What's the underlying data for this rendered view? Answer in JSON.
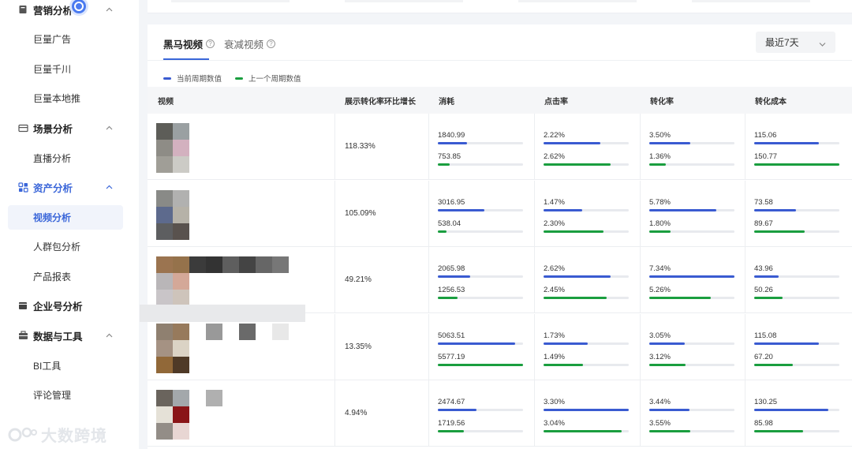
{
  "sidebar": {
    "groups": [
      {
        "label": "营销分析",
        "icon": "doc-icon"
      },
      {
        "label": "场景分析",
        "icon": "card-icon"
      },
      {
        "label": "资产分析",
        "icon": "assets-icon"
      },
      {
        "label": "企业号分析",
        "icon": "enterprise-icon"
      },
      {
        "label": "数据与工具",
        "icon": "toolbox-icon"
      }
    ],
    "items": [
      {
        "label": "巨量广告"
      },
      {
        "label": "巨量千川"
      },
      {
        "label": "巨量本地推"
      },
      {
        "label": "直播分析"
      },
      {
        "label": "视频分析"
      },
      {
        "label": "人群包分析"
      },
      {
        "label": "产品报表"
      },
      {
        "label": "BI工具"
      },
      {
        "label": "评论管理"
      }
    ],
    "watermark": "大数跨境"
  },
  "tabs": [
    {
      "label": "黑马视频"
    },
    {
      "label": "衰减视频"
    }
  ],
  "period_select": {
    "value": "最近7天"
  },
  "legend": [
    {
      "label": "当前周期数值",
      "color": "#3a5bd1"
    },
    {
      "label": "上一个周期数值",
      "color": "#1a9e3f"
    }
  ],
  "columns": [
    "视频",
    "展示转化率环比增长",
    "消耗",
    "点击率",
    "转化率",
    "转化成本"
  ],
  "rows": [
    {
      "growth": "118.33%",
      "spend": [
        "1840.99",
        "753.85"
      ],
      "spend_bar": [
        0.34,
        0.14
      ],
      "ctr": [
        "2.22%",
        "2.62%"
      ],
      "ctr_bar": [
        0.67,
        0.79
      ],
      "cvr": [
        "3.50%",
        "1.36%"
      ],
      "cvr_bar": [
        0.48,
        0.19
      ],
      "cost": [
        "115.06",
        "150.77"
      ],
      "cost_bar": [
        0.76,
        1.0
      ]
    },
    {
      "growth": "105.09%",
      "spend": [
        "3016.95",
        "538.04"
      ],
      "spend_bar": [
        0.55,
        0.1
      ],
      "ctr": [
        "1.47%",
        "2.30%"
      ],
      "ctr_bar": [
        0.45,
        0.7
      ],
      "cvr": [
        "5.78%",
        "1.80%"
      ],
      "cvr_bar": [
        0.79,
        0.25
      ],
      "cost": [
        "73.58",
        "89.67"
      ],
      "cost_bar": [
        0.49,
        0.59
      ]
    },
    {
      "growth": "49.21%",
      "spend": [
        "2065.98",
        "1256.53"
      ],
      "spend_bar": [
        0.38,
        0.23
      ],
      "ctr": [
        "2.62%",
        "2.45%"
      ],
      "ctr_bar": [
        0.79,
        0.74
      ],
      "cvr": [
        "7.34%",
        "5.26%"
      ],
      "cvr_bar": [
        1.0,
        0.72
      ],
      "cost": [
        "43.96",
        "50.26"
      ],
      "cost_bar": [
        0.29,
        0.33
      ]
    },
    {
      "growth": "13.35%",
      "spend": [
        "5063.51",
        "5577.19"
      ],
      "spend_bar": [
        0.91,
        1.0
      ],
      "ctr": [
        "1.73%",
        "1.49%"
      ],
      "ctr_bar": [
        0.52,
        0.46
      ],
      "cvr": [
        "3.05%",
        "3.12%"
      ],
      "cvr_bar": [
        0.42,
        0.43
      ],
      "cost": [
        "115.08",
        "67.20"
      ],
      "cost_bar": [
        0.76,
        0.45
      ]
    },
    {
      "growth": "4.94%",
      "spend": [
        "2474.67",
        "1719.56"
      ],
      "spend_bar": [
        0.45,
        0.31
      ],
      "ctr": [
        "3.30%",
        "3.04%"
      ],
      "ctr_bar": [
        1.0,
        0.92
      ],
      "cvr": [
        "3.44%",
        "3.55%"
      ],
      "cvr_bar": [
        0.47,
        0.48
      ],
      "cost": [
        "130.25",
        "85.98"
      ],
      "cost_bar": [
        0.87,
        0.57
      ]
    }
  ]
}
